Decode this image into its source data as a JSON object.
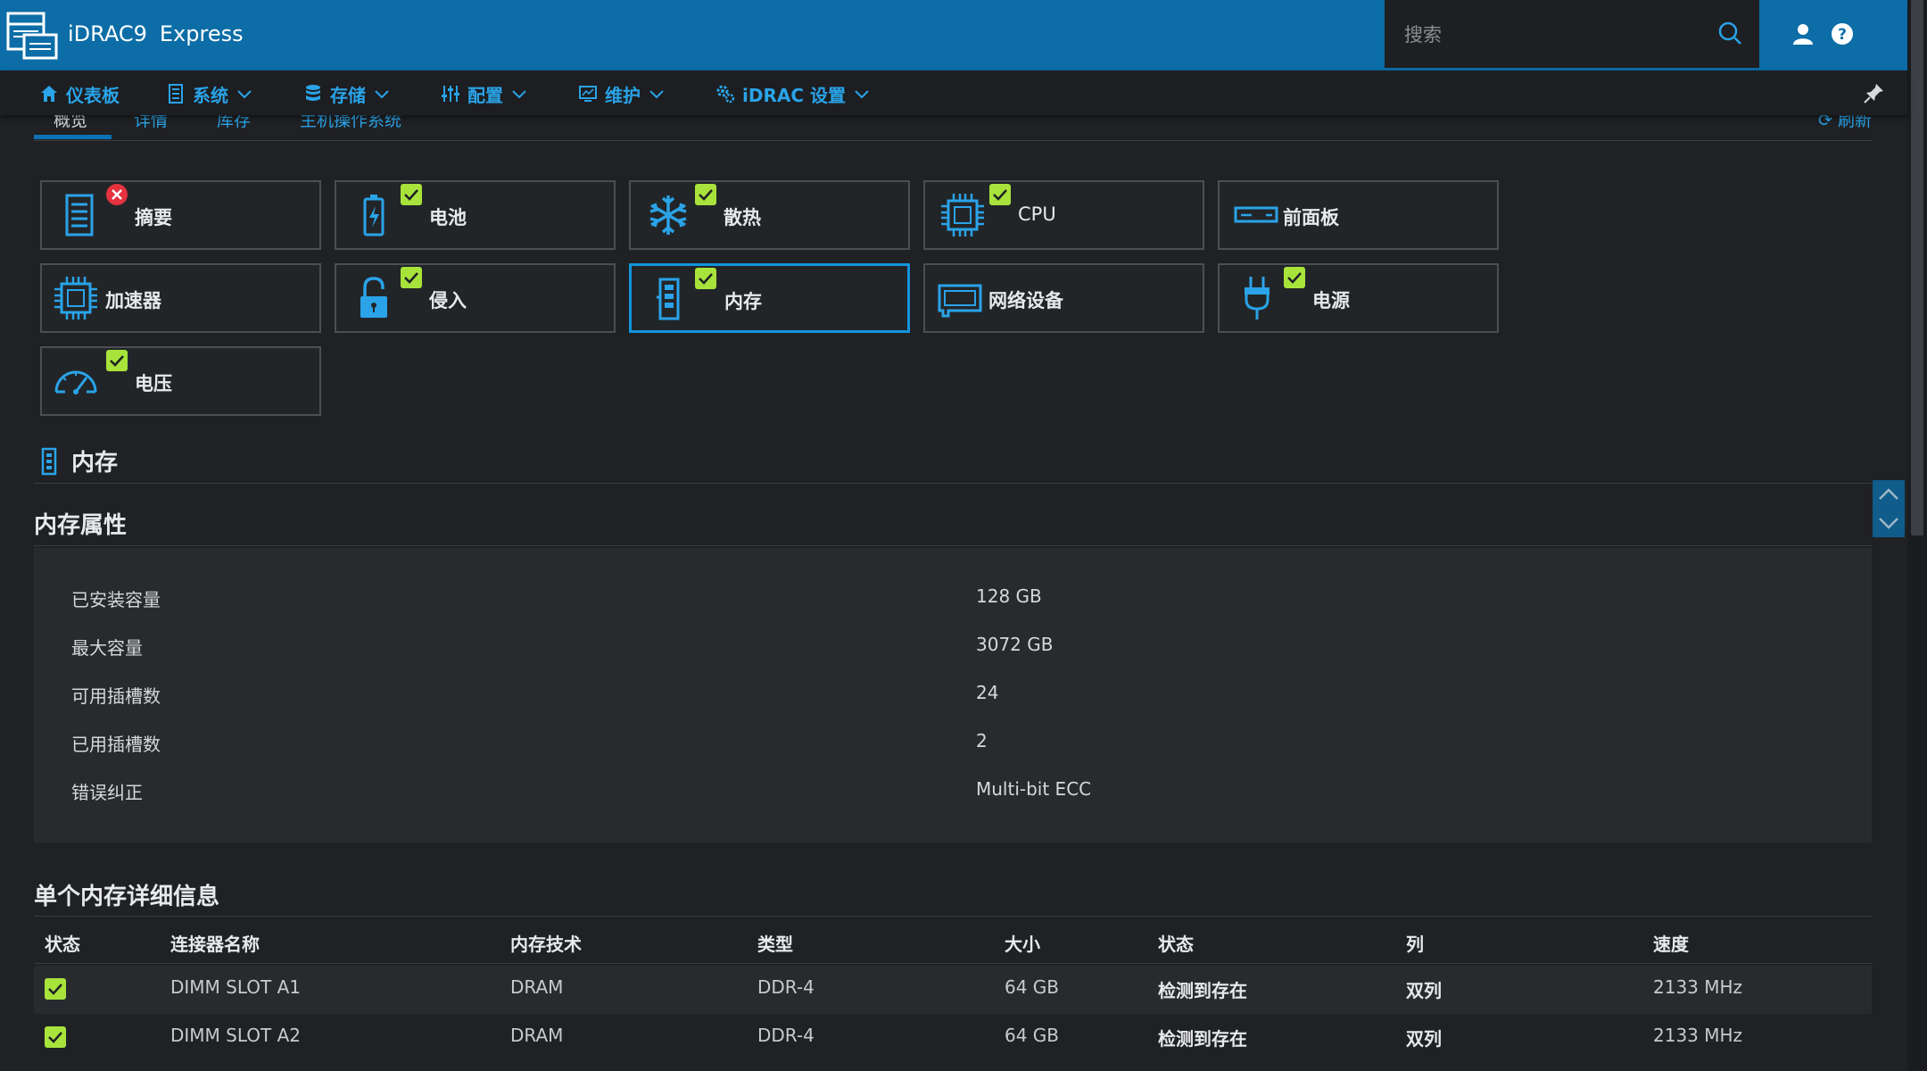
{
  "header": {
    "product": "iDRAC9",
    "edition": "Express",
    "search_placeholder": "搜索",
    "user_icon": "user-icon",
    "help_icon": "help-icon"
  },
  "nav": {
    "items": [
      {
        "label": "仪表板",
        "icon": "home-icon",
        "has_menu": false
      },
      {
        "label": "系统",
        "icon": "server-icon",
        "has_menu": true
      },
      {
        "label": "存储",
        "icon": "database-icon",
        "has_menu": true
      },
      {
        "label": "配置",
        "icon": "sliders-icon",
        "has_menu": true
      },
      {
        "label": "维护",
        "icon": "monitor-icon",
        "has_menu": true
      },
      {
        "label": "iDRAC 设置",
        "icon": "gears-icon",
        "has_menu": true
      }
    ]
  },
  "subtabs": {
    "items": [
      "概览",
      "详情",
      "库存",
      "主机操作系统"
    ],
    "active": "概览",
    "refresh": "刷新"
  },
  "tiles": [
    {
      "label": "摘要",
      "icon": "summary-icon",
      "status": "error"
    },
    {
      "label": "电池",
      "icon": "battery-icon",
      "status": "ok"
    },
    {
      "label": "散热",
      "icon": "fan-icon",
      "status": "ok"
    },
    {
      "label": "CPU",
      "icon": "cpu-icon",
      "status": "ok"
    },
    {
      "label": "前面板",
      "icon": "front-panel-icon",
      "status": "none"
    },
    {
      "label": "加速器",
      "icon": "accelerator-icon",
      "status": "none"
    },
    {
      "label": "侵入",
      "icon": "lock-icon",
      "status": "ok"
    },
    {
      "label": "内存",
      "icon": "memory-icon",
      "status": "ok",
      "selected": true
    },
    {
      "label": "网络设备",
      "icon": "network-card-icon",
      "status": "none"
    },
    {
      "label": "电源",
      "icon": "power-plug-icon",
      "status": "ok"
    },
    {
      "label": "电压",
      "icon": "gauge-icon",
      "status": "ok"
    }
  ],
  "section": {
    "title": "内存",
    "properties_title": "内存属性",
    "properties": [
      {
        "key": "已安装容量",
        "value": "128 GB"
      },
      {
        "key": "最大容量",
        "value": "3072 GB"
      },
      {
        "key": "可用插槽数",
        "value": "24"
      },
      {
        "key": "已用插槽数",
        "value": "2"
      },
      {
        "key": "错误纠正",
        "value": "Multi-bit ECC"
      }
    ],
    "details_title": "单个内存详细信息",
    "columns": [
      "状态",
      "连接器名称",
      "内存技术",
      "类型",
      "大小",
      "状态",
      "列",
      "速度"
    ],
    "rows": [
      {
        "status": "ok",
        "connector": "DIMM SLOT A1",
        "tech": "DRAM",
        "type": "DDR-4",
        "size": "64 GB",
        "state": "检测到存在",
        "rank": "双列",
        "speed": "2133 MHz"
      },
      {
        "status": "ok",
        "connector": "DIMM SLOT A2",
        "tech": "DRAM",
        "type": "DDR-4",
        "size": "64 GB",
        "state": "检测到存在",
        "rank": "双列",
        "speed": "2133 MHz"
      }
    ]
  },
  "colors": {
    "header_blue": "#0c6da7",
    "accent": "#2aa3e8",
    "ok_green": "#a8e33c",
    "error_red": "#e5323f",
    "background": "#1f2124"
  }
}
